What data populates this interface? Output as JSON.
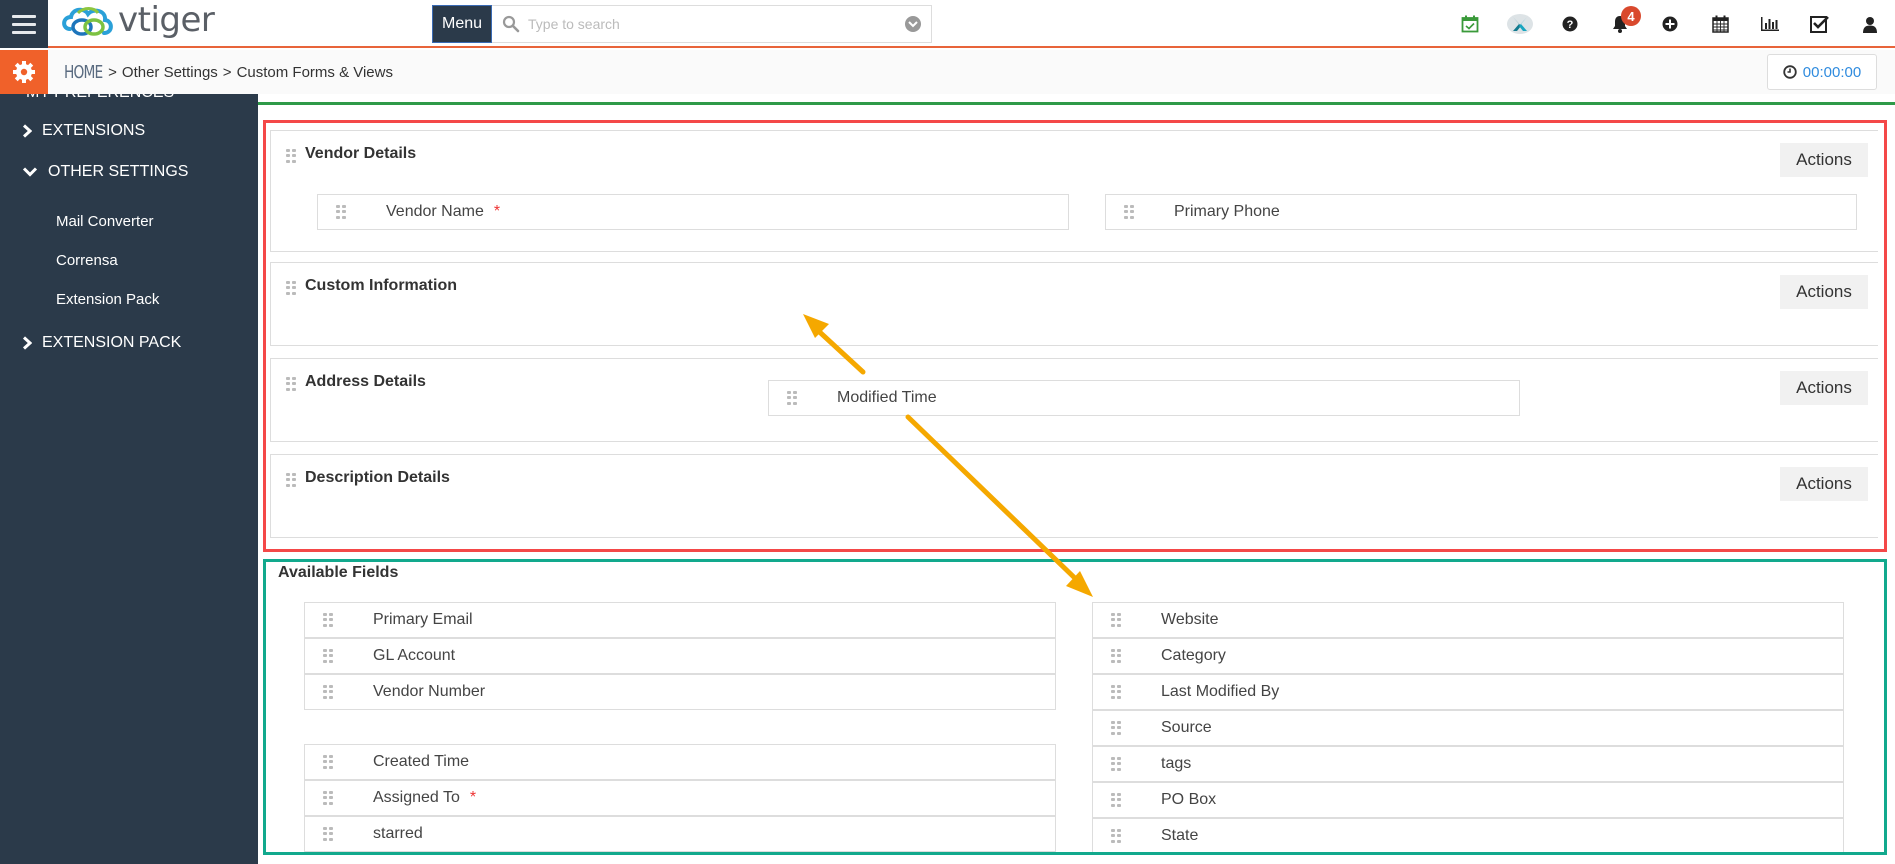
{
  "header": {
    "logo_text": "vtiger",
    "menu_label": "Menu",
    "search_placeholder": "Type to search",
    "notification_count": "4",
    "icons": [
      "calendar-check-icon",
      "x-app-icon",
      "help-icon",
      "bell-icon",
      "add-icon",
      "calendar-icon",
      "reports-icon",
      "tasks-icon",
      "user-icon"
    ]
  },
  "breadcrumb": {
    "home": "HOME",
    "items": [
      "Other Settings",
      "Custom Forms & Views"
    ]
  },
  "timer": "00:00:00",
  "sidebar": {
    "clipped_item": "MY PREFERENCES",
    "groups": [
      {
        "label": "EXTENSIONS",
        "expanded": false
      },
      {
        "label": "OTHER SETTINGS",
        "expanded": true,
        "items": [
          "Mail Converter",
          "Corrensa",
          "Extension Pack"
        ]
      },
      {
        "label": "EXTENSION PACK",
        "expanded": false
      }
    ]
  },
  "blocks": [
    {
      "title": "Vendor Details",
      "actions_label": "Actions",
      "fields_left": [
        {
          "label": "Vendor Name",
          "required": true
        }
      ],
      "fields_right": [
        {
          "label": "Primary Phone",
          "required": false
        }
      ]
    },
    {
      "title": "Custom Information",
      "actions_label": "Actions"
    },
    {
      "title": "Address Details",
      "actions_label": "Actions",
      "dragging_field": "Modified Time"
    },
    {
      "title": "Description Details",
      "actions_label": "Actions"
    }
  ],
  "available": {
    "title": "Available Fields",
    "left": [
      {
        "label": "Primary Email",
        "required": false
      },
      {
        "label": "GL Account",
        "required": false
      },
      {
        "label": "Vendor Number",
        "required": false
      },
      {
        "label": "Created Time",
        "required": false
      },
      {
        "label": "Assigned To",
        "required": true
      },
      {
        "label": "starred",
        "required": false
      }
    ],
    "right": [
      {
        "label": "Website",
        "required": false
      },
      {
        "label": "Category",
        "required": false
      },
      {
        "label": "Last Modified By",
        "required": false
      },
      {
        "label": "Source",
        "required": false
      },
      {
        "label": "tags",
        "required": false
      },
      {
        "label": "PO Box",
        "required": false
      },
      {
        "label": "State",
        "required": false
      }
    ]
  },
  "colors": {
    "accent_orange": "#f0612a",
    "sidebar_bg": "#2b3a4a",
    "highlight_red": "#f44848",
    "highlight_teal": "#12a98d",
    "arrow": "#f5a800",
    "timer_blue": "#2f8bde"
  }
}
